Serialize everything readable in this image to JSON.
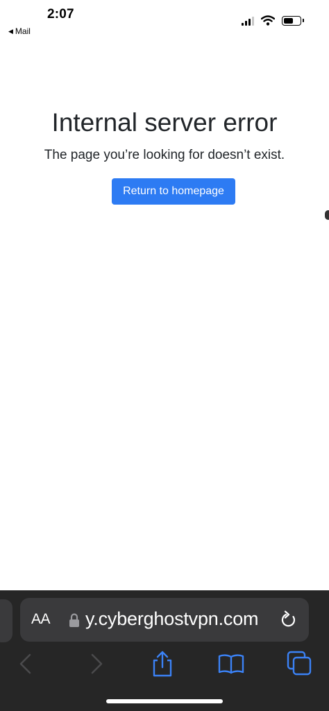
{
  "status_bar": {
    "time": "2:07",
    "back_app": "Mail"
  },
  "page": {
    "title": "Internal server error",
    "message": "The page you’re looking for doesn’t exist.",
    "button_label": "Return to homepage",
    "accent_color": "#2d7bf3"
  },
  "browser": {
    "text_size_label": "AA",
    "url": "y.cyberghostvpn.com",
    "icons": [
      "lock-icon",
      "reload-icon",
      "back-icon",
      "forward-icon",
      "share-icon",
      "bookmarks-icon",
      "tabs-icon"
    ],
    "toolbar_color": "#262626",
    "icon_color": "#3b82f6"
  }
}
